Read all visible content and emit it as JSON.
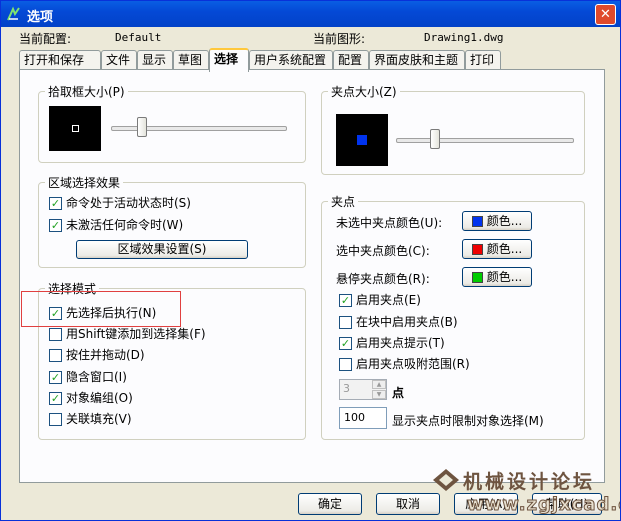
{
  "window": {
    "title": "选项",
    "close_label": "✕"
  },
  "header": {
    "current_profile_label": "当前配置:",
    "current_profile_value": "Default",
    "current_drawing_label": "当前图形:",
    "current_drawing_value": "Drawing1.dwg"
  },
  "tabs": [
    {
      "label": "打开和保存"
    },
    {
      "label": "文件"
    },
    {
      "label": "显示"
    },
    {
      "label": "草图"
    },
    {
      "label": "选择",
      "active": true
    },
    {
      "label": "用户系统配置"
    },
    {
      "label": "配置"
    },
    {
      "label": "界面皮肤和主题"
    },
    {
      "label": "打印"
    }
  ],
  "pickbox": {
    "title": "拾取框大小(P)"
  },
  "grip_size": {
    "title": "夹点大小(Z)"
  },
  "area_selection": {
    "title": "区域选择效果",
    "items": [
      {
        "label": "命令处于活动状态时(S)",
        "checked": true
      },
      {
        "label": "未激活任何命令时(W)",
        "checked": true
      }
    ],
    "settings_button": "区域效果设置(S)"
  },
  "selection_mode": {
    "title": "选择模式",
    "items": [
      {
        "label": "先选择后执行(N)",
        "checked": true
      },
      {
        "label": "用Shift键添加到选择集(F)",
        "checked": false
      },
      {
        "label": "按住并拖动(D)",
        "checked": false
      },
      {
        "label": "隐含窗口(I)",
        "checked": true
      },
      {
        "label": "对象编组(O)",
        "checked": true
      },
      {
        "label": "关联填充(V)",
        "checked": false
      }
    ]
  },
  "grips": {
    "title": "夹点",
    "unselected_color_label": "未选中夹点颜色(U):",
    "selected_color_label": "选中夹点颜色(C):",
    "hover_color_label": "悬停夹点颜色(R):",
    "color_button_label": "颜色...",
    "colors": {
      "unselected": "#0033ee",
      "selected": "#ee0000",
      "hover": "#00cc00"
    },
    "items": [
      {
        "label": "启用夹点(E)",
        "checked": true
      },
      {
        "label": "在块中启用夹点(B)",
        "checked": false
      },
      {
        "label": "启用夹点提示(T)",
        "checked": true
      },
      {
        "label": "启用夹点吸附范围(R)",
        "checked": false
      }
    ],
    "snap_value": "3",
    "snap_unit_label": "点",
    "limit_value": "100",
    "limit_label": "显示夹点时限制对象选择(M)"
  },
  "footer": {
    "ok": "确定",
    "cancel": "取消",
    "apply": "应用(A)",
    "help": "帮助(H)"
  },
  "watermark": {
    "text": "机械设计论坛",
    "url": "www.zgjxcad.com"
  }
}
